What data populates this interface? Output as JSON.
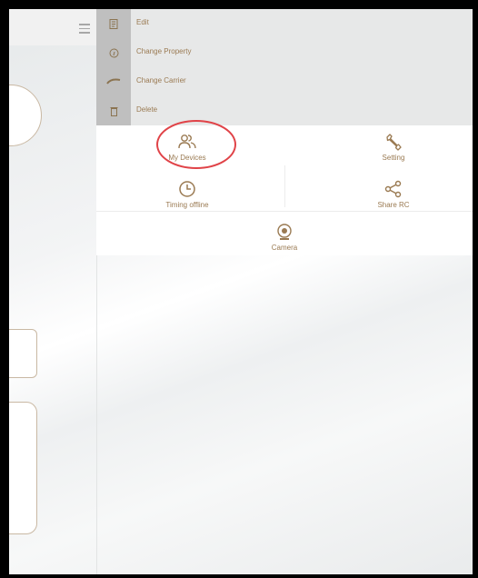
{
  "menu": {
    "items": [
      {
        "label": "Edit",
        "icon": "edit-icon"
      },
      {
        "label": "Change Property",
        "icon": "info-icon"
      },
      {
        "label": "Change Carrier",
        "icon": "carrier-icon"
      },
      {
        "label": "Delete",
        "icon": "trash-icon"
      }
    ]
  },
  "grid": {
    "my_devices": "My Devices",
    "setting": "Setting",
    "timing_offline": "Timing offline",
    "share_rc": "Share RC",
    "camera": "Camera"
  },
  "colors": {
    "accent": "#9a7a52",
    "menu_bg": "#e7e8e8",
    "icon_cell": "#bfbfbf",
    "highlight_circle": "#e04348"
  }
}
